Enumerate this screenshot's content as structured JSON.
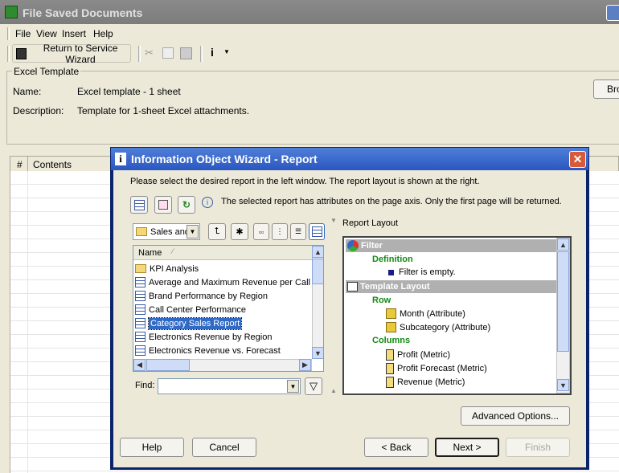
{
  "window": {
    "title": "File Saved Documents"
  },
  "menu": [
    "File",
    "View",
    "Insert",
    "Help"
  ],
  "toolbar": {
    "return_label": "Return to Service Wizard"
  },
  "template": {
    "legend": "Excel Template",
    "name_label": "Name:",
    "name_value": "Excel template - 1 sheet",
    "desc_label": "Description:",
    "desc_value": "Template for 1-sheet Excel attachments.",
    "browse_label": "Bro"
  },
  "list": {
    "col_num": "#",
    "col_contents": "Contents"
  },
  "dialog": {
    "title": "Information Object Wizard - Report",
    "instruction": "Please select the desired report in the left window. The report layout is shown at the right.",
    "notice": "The selected report has attributes on the page axis. Only the first page will be returned.",
    "folder_select": "Sales and",
    "name_header": "Name",
    "reports": [
      {
        "label": "KPI Analysis",
        "icon": "folder-icon"
      },
      {
        "label": "Average and Maximum Revenue per Call C",
        "icon": "report-grid-icon"
      },
      {
        "label": "Brand Performance by Region",
        "icon": "report-grid-icon"
      },
      {
        "label": "Call Center Performance",
        "icon": "report-grid-icon"
      },
      {
        "label": "Category Sales Report",
        "icon": "report-grid-icon",
        "selected": true
      },
      {
        "label": "Electronics Revenue by Region",
        "icon": "report-grid-icon"
      },
      {
        "label": "Electronics Revenue vs. Forecast",
        "icon": "report-grid-icon"
      }
    ],
    "find_label": "Find:",
    "find_value": "",
    "layout_label": "Report Layout",
    "layout": {
      "filter_header": "Filter",
      "definition": "Definition",
      "filter_empty": "Filter is empty.",
      "template_header": "Template Layout",
      "row": "Row",
      "row_items": [
        "Month (Attribute)",
        "Subcategory (Attribute)"
      ],
      "columns": "Columns",
      "column_items": [
        "Profit (Metric)",
        "Profit Forecast (Metric)",
        "Revenue (Metric)"
      ]
    },
    "advanced_label": "Advanced Options...",
    "help_label": "Help",
    "cancel_label": "Cancel",
    "back_label": "< Back",
    "next_label": "Next >",
    "finish_label": "Finish"
  },
  "colors": {
    "selection": "#316ac5",
    "dialog_title": "#2a57c0",
    "green_text": "#138a13"
  }
}
